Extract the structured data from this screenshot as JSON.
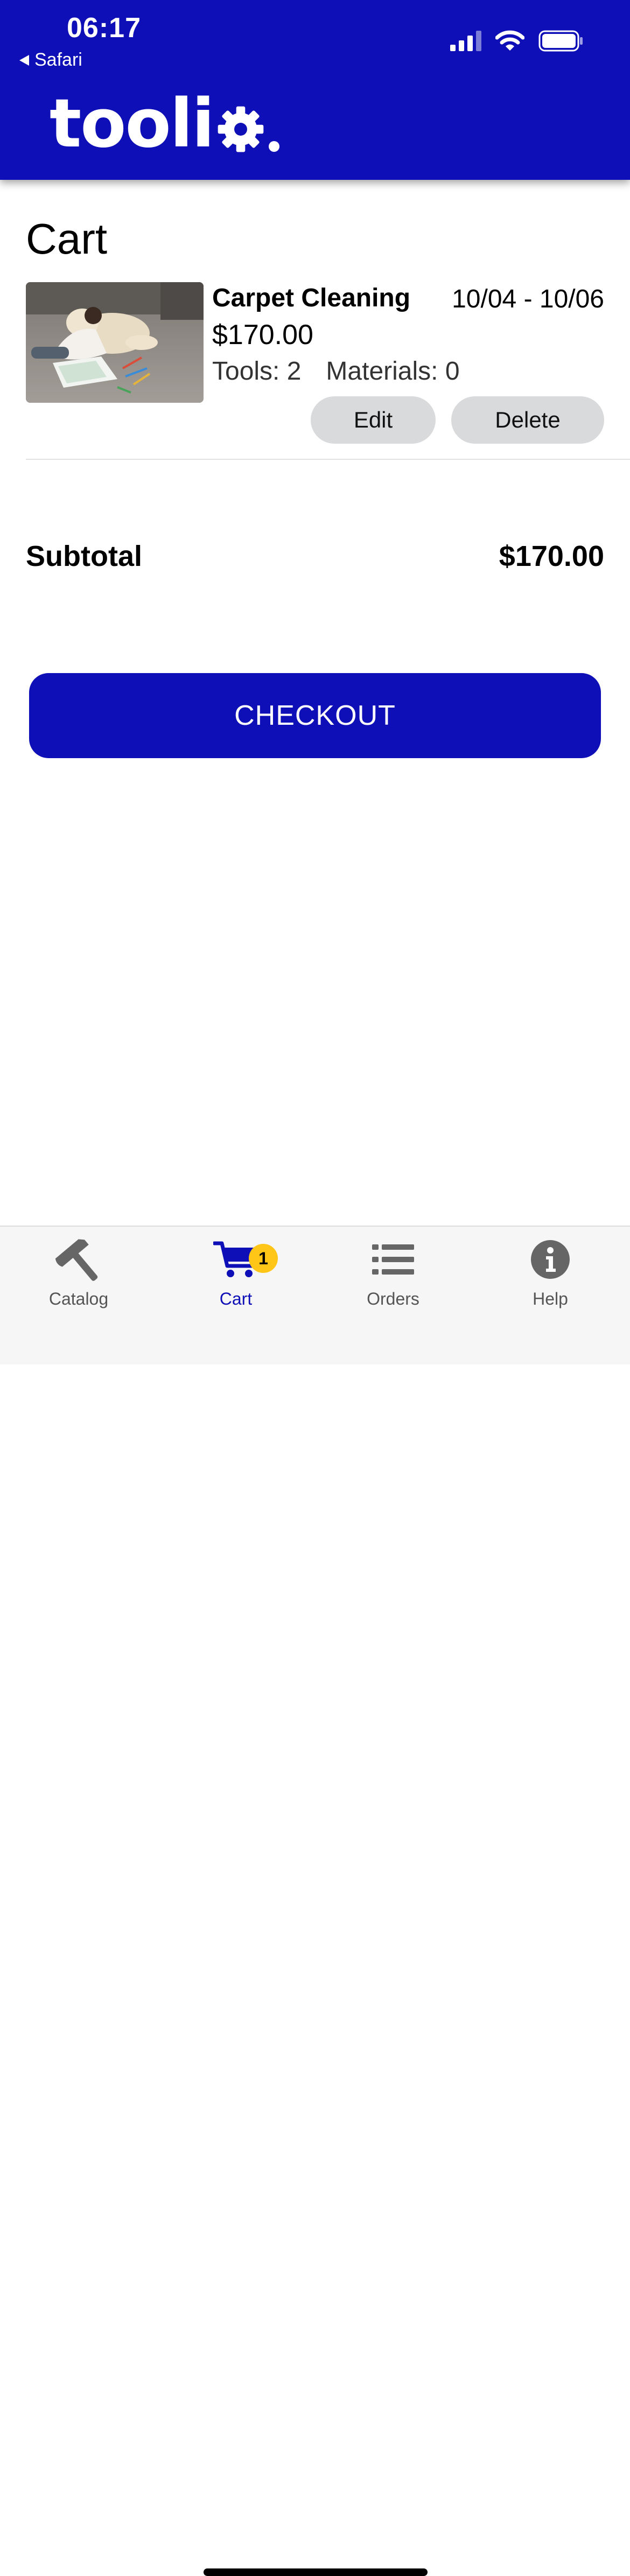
{
  "status_bar": {
    "time": "06:17",
    "back_app": "Safari",
    "icons": [
      "cellular-signal-icon",
      "wifi-icon",
      "battery-icon"
    ]
  },
  "header": {
    "logo_text": "tooli",
    "accent_color": "#0f0fb8"
  },
  "page": {
    "title": "Cart"
  },
  "cart_item": {
    "name": "Carpet Cleaning",
    "dates": "10/04 - 10/06",
    "price": "$170.00",
    "tools": "Tools: 2",
    "materials": "Materials: 0",
    "edit_label": "Edit",
    "delete_label": "Delete"
  },
  "summary": {
    "subtotal_label": "Subtotal",
    "subtotal_value": "$170.00"
  },
  "checkout": {
    "label": "CHECKOUT"
  },
  "tabbar": {
    "tabs": [
      {
        "label": "Catalog",
        "icon": "hammer-icon",
        "active": false
      },
      {
        "label": "Cart",
        "icon": "cart-icon",
        "active": true,
        "badge": "1"
      },
      {
        "label": "Orders",
        "icon": "list-icon",
        "active": false
      },
      {
        "label": "Help",
        "icon": "info-icon",
        "active": false
      }
    ],
    "badge_color": "#ffc617"
  }
}
